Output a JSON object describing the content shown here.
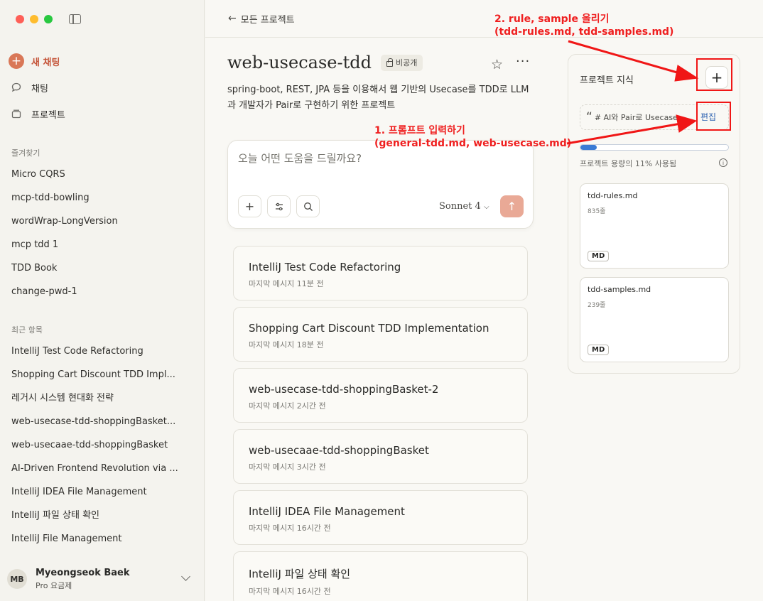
{
  "sidebar": {
    "new_chat": "새 채팅",
    "chats": "채팅",
    "projects": "프로젝트",
    "favorites_title": "즐겨찾기",
    "favorites": [
      "Micro CQRS",
      "mcp-tdd-bowling",
      "wordWrap-LongVersion",
      "mcp tdd 1",
      "TDD Book",
      "change-pwd-1"
    ],
    "recents_title": "최근 항목",
    "recents": [
      "IntelliJ Test Code Refactoring",
      "Shopping Cart Discount TDD Impl...",
      "레거시 시스템 현대화 전략",
      "web-usecase-tdd-shoppingBasket...",
      "web-usecaae-tdd-shoppingBasket",
      "AI-Driven Frontend Revolution via ...",
      "IntelliJ IDEA File Management",
      "IntelliJ 파일 상태 확인",
      "IntelliJ File Management"
    ],
    "user": {
      "initials": "MB",
      "name": "Myeongseok Baek",
      "plan": "Pro 요금제"
    }
  },
  "topbar": {
    "back_label": "모든 프로젝트"
  },
  "project": {
    "title": "web-usecase-tdd",
    "visibility": "비공개",
    "description": "spring-boot, REST, JPA 등을 이용해서 웹 기반의 Usecase를 TDD로 LLM과 개발자가 Pair로 구현하기 위한 프로젝트"
  },
  "composer": {
    "placeholder": "오늘 어떤 도움을 드릴까요?",
    "model": "Sonnet 4"
  },
  "chats": [
    {
      "title": "IntelliJ Test Code Refactoring",
      "meta": "마지막 메시지 11분 전"
    },
    {
      "title": "Shopping Cart Discount TDD Implementation",
      "meta": "마지막 메시지 18분 전"
    },
    {
      "title": "web-usecase-tdd-shoppingBasket-2",
      "meta": "마지막 메시지 2시간 전"
    },
    {
      "title": "web-usecaae-tdd-shoppingBasket",
      "meta": "마지막 메시지 3시간 전"
    },
    {
      "title": "IntelliJ IDEA File Management",
      "meta": "마지막 메시지 16시간 전"
    },
    {
      "title": "IntelliJ 파일 상태 확인",
      "meta": "마지막 메시지 16시간 전"
    }
  ],
  "knowledge": {
    "title": "프로젝트 지식",
    "prompt_preview": "# AI와 Pair로 Usecase를 T...",
    "edit_label": "편집",
    "usage_text": "프로젝트 용량의 11% 사용됨",
    "usage_fraction": 0.11,
    "files": [
      {
        "name": "tdd-rules.md",
        "lines": "835줄",
        "type": "MD"
      },
      {
        "name": "tdd-samples.md",
        "lines": "239줄",
        "type": "MD"
      }
    ]
  },
  "annotations": {
    "rules_line1": "2. rule, sample 올리기",
    "rules_line2": "(tdd-rules.md, tdd-samples.md)",
    "prompt_line1": "1. 프롬프트 입력하기",
    "prompt_line2": "(general-tdd.md, web-usecase.md)",
    "color": "#ef1f1f"
  }
}
